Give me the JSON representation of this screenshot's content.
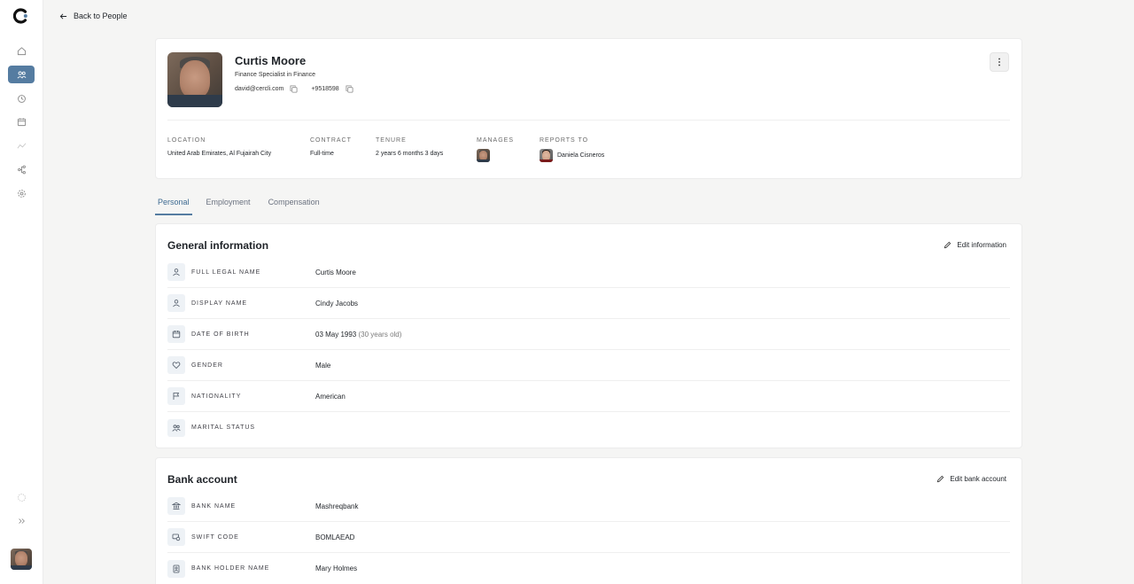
{
  "back_link": {
    "label": "Back to People"
  },
  "sidebar": {
    "items": [
      {
        "name": "home-icon",
        "active": false
      },
      {
        "name": "people-icon",
        "active": true
      },
      {
        "name": "time-off-icon",
        "active": false
      },
      {
        "name": "calendar-icon",
        "active": false
      },
      {
        "name": "analytics-icon",
        "active": false
      },
      {
        "name": "org-chart-icon",
        "active": false
      },
      {
        "name": "settings-icon",
        "active": false
      }
    ],
    "accent": "#557ca1"
  },
  "profile": {
    "name": "Curtis Moore",
    "title": "Finance Specialist in Finance",
    "email": "david@cercli.com",
    "phone": "+9518598",
    "location_label": "LOCATION",
    "location": "United Arab Emirates, Al Fujairah City",
    "contract_label": "CONTRACT",
    "contract": "Full-time",
    "tenure_label": "TENURE",
    "tenure": "2 years 6 months 3 days",
    "manages_label": "MANAGES",
    "reports_to_label": "REPORTS TO",
    "reports_to": "Daniela Cisneros"
  },
  "tabs": [
    {
      "label": "Personal",
      "active": true
    },
    {
      "label": "Employment",
      "active": false
    },
    {
      "label": "Compensation",
      "active": false
    }
  ],
  "general_info": {
    "title": "General information",
    "edit_label": "Edit information",
    "rows": [
      {
        "icon": "user-icon",
        "label": "FULL LEGAL NAME",
        "value": "Curtis Moore",
        "sub": ""
      },
      {
        "icon": "user-icon",
        "label": "DISPLAY NAME",
        "value": "Cindy Jacobs",
        "sub": ""
      },
      {
        "icon": "calendar-icon",
        "label": "DATE OF BIRTH",
        "value": "03 May 1993",
        "sub": "(30 years old)"
      },
      {
        "icon": "heart-icon",
        "label": "GENDER",
        "value": "Male",
        "sub": ""
      },
      {
        "icon": "flag-icon",
        "label": "NATIONALITY",
        "value": "American",
        "sub": ""
      },
      {
        "icon": "users-icon",
        "label": "MARITAL STATUS",
        "value": "",
        "sub": ""
      }
    ]
  },
  "bank_account": {
    "title": "Bank account",
    "edit_label": "Edit bank account",
    "rows": [
      {
        "icon": "bank-icon",
        "label": "BANK NAME",
        "value": "Mashreqbank"
      },
      {
        "icon": "swift-icon",
        "label": "SWIFT CODE",
        "value": "BOMLAEAD"
      },
      {
        "icon": "id-card-icon",
        "label": "BANK HOLDER NAME",
        "value": "Mary Holmes"
      }
    ]
  }
}
